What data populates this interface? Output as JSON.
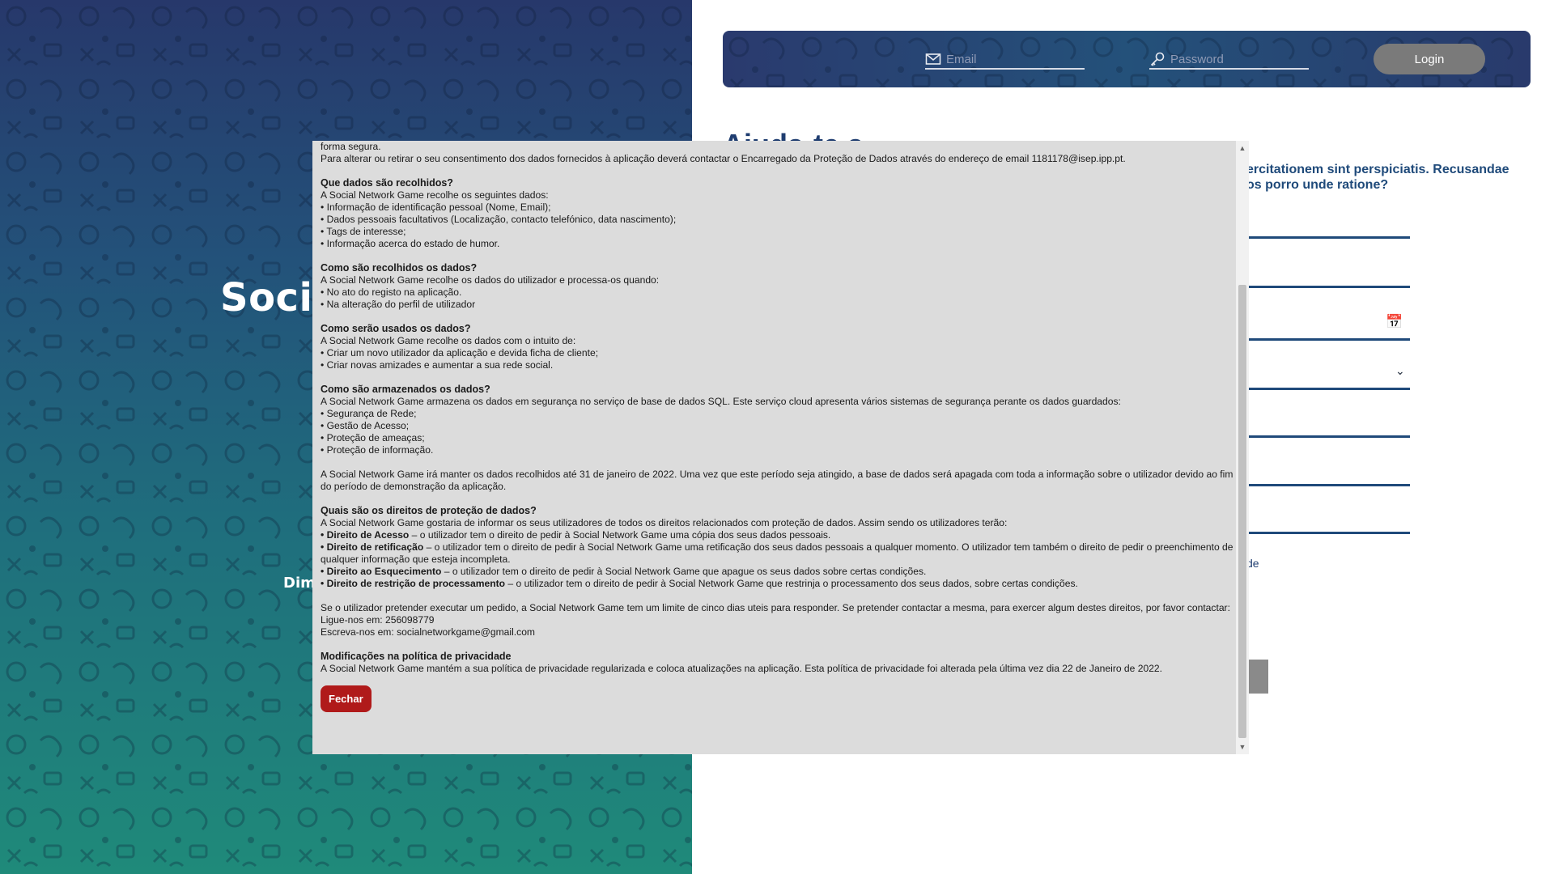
{
  "left": {
    "title": "Socia",
    "subtitle": "Dim"
  },
  "login": {
    "email_placeholder": "Email",
    "password_placeholder": "Password",
    "login_label": "Login"
  },
  "background": {
    "desc_line1": "ercitationem sint perspiciatis. Recusandae",
    "desc_line2": "os porro unde ratione?",
    "link_fragment": "de"
  },
  "modal": {
    "intro": [
      "forma segura.",
      "Para alterar ou retirar o seu consentimento dos dados fornecidos à aplicação deverá contactar o Encarregado da Proteção de Dados através do endereço de email 1181178@isep.ipp.pt."
    ],
    "sec1": {
      "heading": "Que dados são recolhidos?",
      "lines": [
        "A Social Network Game recolhe os seguintes dados:",
        "• Informação de identificação pessoal (Nome, Email);",
        "• Dados pessoais facultativos (Localização, contacto telefónico, data nascimento);",
        "• Tags de interesse;",
        "• Informação acerca do estado de humor."
      ]
    },
    "sec2": {
      "heading": "Como são recolhidos os dados?",
      "lines": [
        "A Social Network Game recolhe os dados do utilizador e processa-os quando:",
        "• No ato do registo na aplicação.",
        "• Na alteração do perfil de utilizador"
      ]
    },
    "sec3": {
      "heading": "Como serão usados os dados?",
      "lines": [
        "A Social Network Game recolhe os dados com o intuito de:",
        "• Criar um novo utilizador da aplicação e devida ficha de cliente;",
        "• Criar novas amizades e aumentar a sua rede social."
      ]
    },
    "sec4": {
      "heading": "Como são armazenados os dados?",
      "lines": [
        "A Social Network Game armazena os dados em segurança no serviço de base de dados SQL. Este serviço cloud apresenta vários sistemas de segurança perante os dados guardados:",
        "• Segurança de Rede;",
        "• Gestão de Acesso;",
        "• Proteção de ameaças;",
        "• Proteção de informação."
      ]
    },
    "retention": "A Social Network Game irá manter os dados recolhidos até 31 de janeiro de 2022. Uma vez que este período seja atingido, a base de dados será apagada com toda a informação sobre o utilizador devido ao fim do período de demonstração da aplicação.",
    "sec5": {
      "heading": "Quais são os direitos de proteção de dados?",
      "intro": "A Social Network Game gostaria de informar os seus utilizadores de todos os direitos relacionados com proteção de dados. Assim sendo os utilizadores terão:",
      "rights": [
        {
          "bold": "• Direito de Acesso",
          "text": " – o utilizador tem o direito de pedir à Social Network Game uma cópia dos seus dados pessoais."
        },
        {
          "bold": "• Direito de retificação",
          "text": " – o utilizador tem o direito de pedir à Social Network Game uma retificação dos seus dados pessoais a qualquer momento. O utilizador tem também o direito de pedir o preenchimento de qualquer informação que esteja incompleta."
        },
        {
          "bold": "• Direito ao Esquecimento",
          "text": " – o utilizador tem o direito de pedir à Social Network Game que apague os seus dados sobre certas condições."
        },
        {
          "bold": "• Direito de restrição de processamento",
          "text": " – o utilizador tem o direito de pedir à Social Network Game que restrinja o processamento dos seus dados, sobre certas condições."
        }
      ]
    },
    "contact": [
      "Se o utilizador pretender executar um pedido, a Social Network Game tem um limite de cinco dias uteis para responder. Se pretender contactar a mesma, para exercer algum destes direitos, por favor contactar:",
      "Ligue-nos em: 256098779",
      "Escreva-nos em: socialnetworkgame@gmail.com"
    ],
    "sec6": {
      "heading": "Modificações na política de privacidade",
      "text": "A Social Network Game mantém a sua política de privacidade regularizada e coloca atualizações na aplicação. Esta política de privacidade foi alterada pela última vez dia 22 de Janeiro de 2022."
    },
    "close_label": "Fechar"
  }
}
